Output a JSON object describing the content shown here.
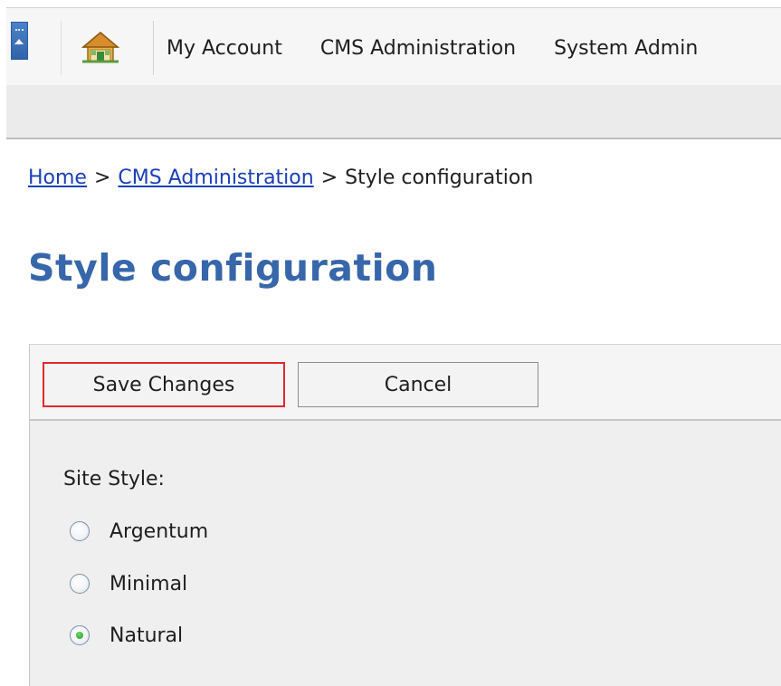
{
  "nav": {
    "items": [
      {
        "label": "My Account"
      },
      {
        "label": "CMS Administration"
      },
      {
        "label": "System Admin"
      }
    ]
  },
  "breadcrumb": {
    "home": "Home",
    "sep1": ">",
    "section": "CMS Administration",
    "sep2": ">",
    "current": "Style configuration"
  },
  "page": {
    "title": "Style configuration"
  },
  "toolbar": {
    "save_label": "Save Changes",
    "cancel_label": "Cancel"
  },
  "form": {
    "field_label": "Site Style:",
    "options": [
      {
        "label": "Argentum",
        "checked": false
      },
      {
        "label": "Minimal",
        "checked": false
      },
      {
        "label": "Natural",
        "checked": true
      }
    ]
  },
  "colors": {
    "title": "#3766aa",
    "link": "#1a3fb8",
    "highlight_border": "#e0282e",
    "radio_selected": "#1f9a22"
  },
  "icons": {
    "collapse": "collapse-up-icon",
    "home": "home-icon"
  }
}
